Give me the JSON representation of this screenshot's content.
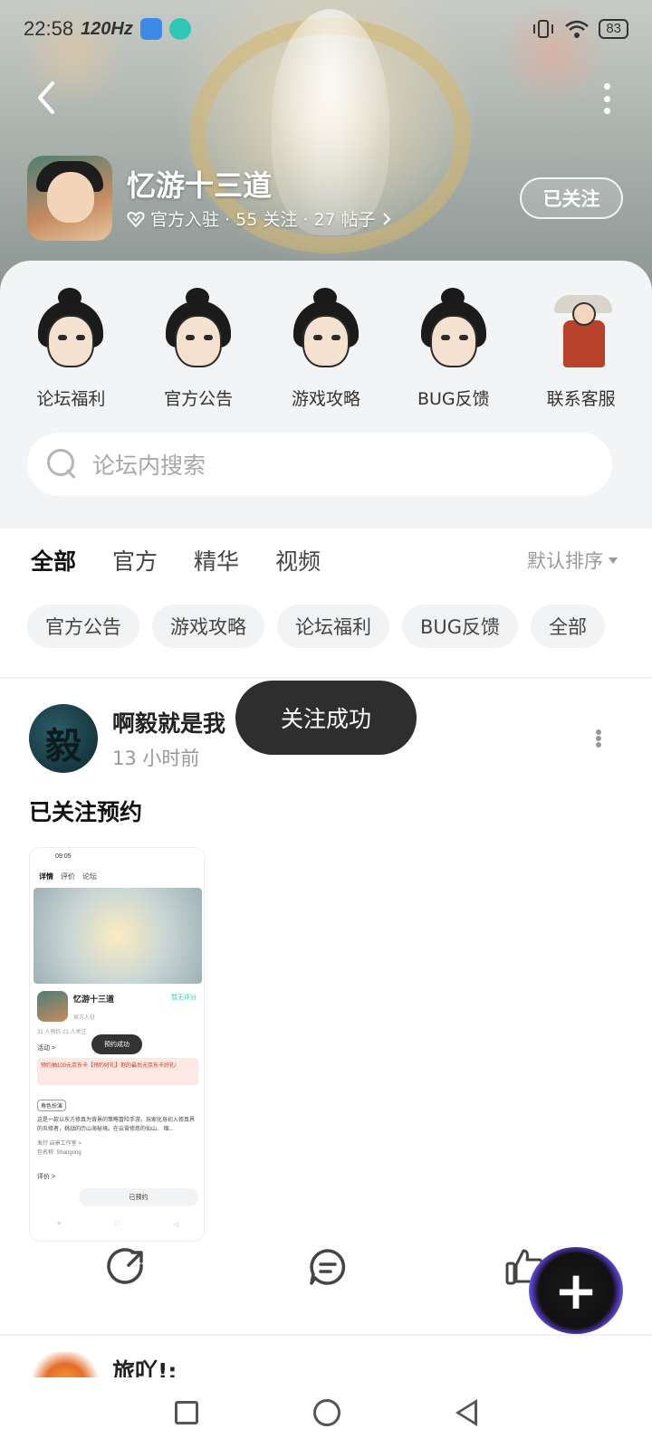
{
  "status_bar": {
    "time": "22:58",
    "refresh": "120Hz",
    "battery": "83"
  },
  "header": {
    "app_name": "忆游十三道",
    "meta": "官方入驻 · 55 关注 · 27 帖子",
    "follow_label": "已关注"
  },
  "shortcuts": [
    {
      "label": "论坛福利"
    },
    {
      "label": "官方公告"
    },
    {
      "label": "游戏攻略"
    },
    {
      "label": "BUG反馈"
    },
    {
      "label": "联系客服"
    }
  ],
  "search": {
    "placeholder": "论坛内搜索"
  },
  "tabs": [
    {
      "label": "全部",
      "active": true
    },
    {
      "label": "官方"
    },
    {
      "label": "精华"
    },
    {
      "label": "视频"
    }
  ],
  "sort_label": "默认排序",
  "chips": [
    "官方公告",
    "游戏攻略",
    "论坛福利",
    "BUG反馈",
    "全部"
  ],
  "post": {
    "author": "啊毅就是我",
    "time": "13 小时前",
    "title": "已关注预约",
    "toast": "关注成功",
    "screenshot": {
      "status_time": "09:05",
      "tabs": [
        "详情",
        "评价",
        "论坛"
      ],
      "app_name": "忆游十三道",
      "link": "暂无评分",
      "sub": "官方入驻",
      "stats": "31 人预约  21 人关注",
      "activity": "活动 >",
      "toast": "预约成功",
      "promo": "预约抽100元京东卡【预约好礼】抱的最后元京东卡好礼!",
      "tag": "角色扮演",
      "desc": "这是一款以东方修真为背景的策略冒险手游。玩家化身初入修真界的炎修者，挑战的历山海秘境。在云霄修炼的仙山、 缩...",
      "dev": "发行  启景工作室 >",
      "pkg": "包名称: Shangong",
      "review": "评价 >",
      "button": "已预约"
    }
  },
  "next_post": {
    "author": "旅吖!;"
  }
}
